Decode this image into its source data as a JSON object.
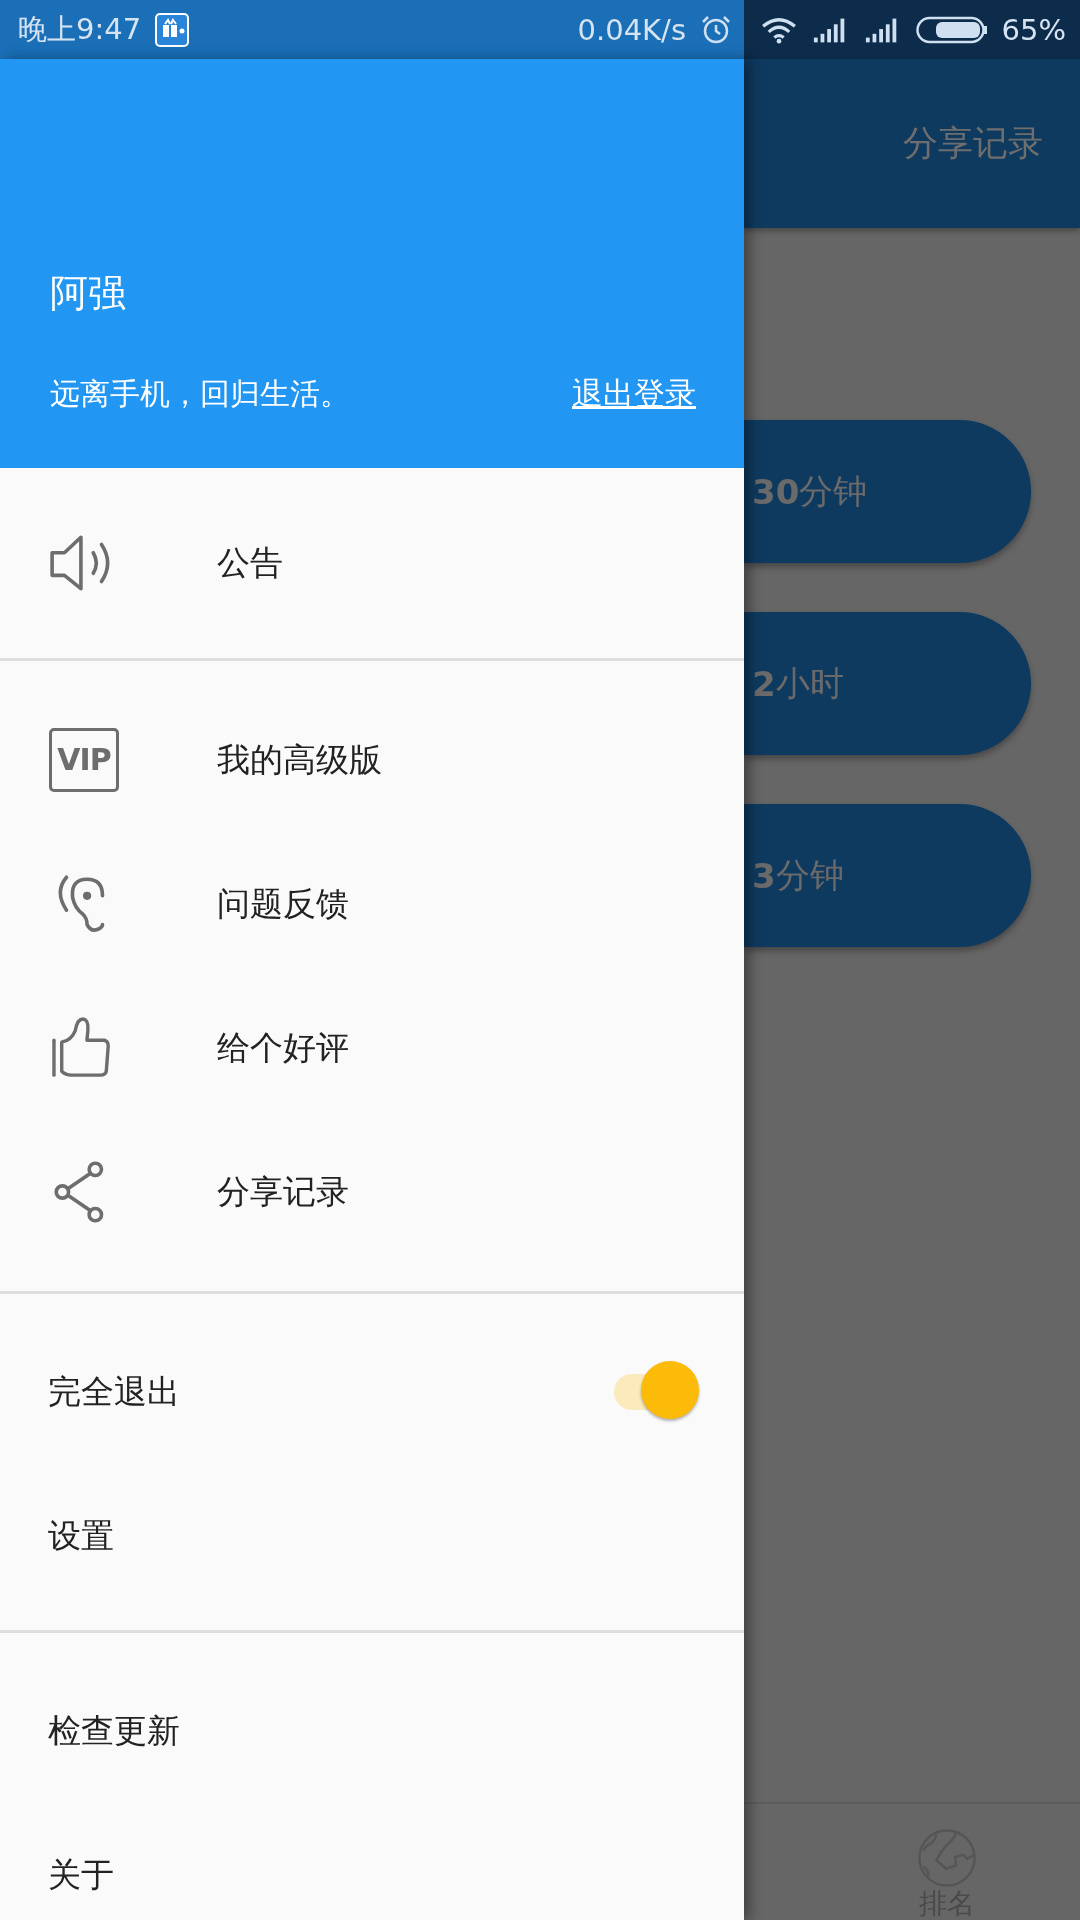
{
  "status_bar": {
    "time": "晚上9:47",
    "speed": "0.04K/s",
    "battery": "65%"
  },
  "drawer": {
    "header": {
      "name": "阿强",
      "motto": "远离手机，回归生活。",
      "logout": "退出登录"
    },
    "sections": [
      {
        "items": [
          {
            "kind": "icon",
            "label": "公告"
          }
        ]
      },
      {
        "items": [
          {
            "kind": "icon",
            "label": "我的高级版",
            "badge": "VIP"
          },
          {
            "kind": "icon",
            "label": "问题反馈"
          },
          {
            "kind": "icon",
            "label": "给个好评"
          },
          {
            "kind": "icon",
            "label": "分享记录"
          }
        ]
      },
      {
        "items": [
          {
            "kind": "toggle",
            "label": "完全退出",
            "on": true
          },
          {
            "kind": "plain",
            "label": "设置"
          }
        ]
      },
      {
        "items": [
          {
            "kind": "plain",
            "label": "检查更新"
          },
          {
            "kind": "plain",
            "label": "关于"
          }
        ]
      }
    ]
  },
  "background": {
    "toolbar_action": "分享记录",
    "buttons": [
      {
        "bold": "30",
        "rest": "分钟"
      },
      {
        "bold": "2",
        "rest": "小时"
      },
      {
        "bold": "3",
        "rest": "分钟"
      }
    ],
    "bottom_nav": [
      {
        "label": "排名"
      }
    ]
  }
}
